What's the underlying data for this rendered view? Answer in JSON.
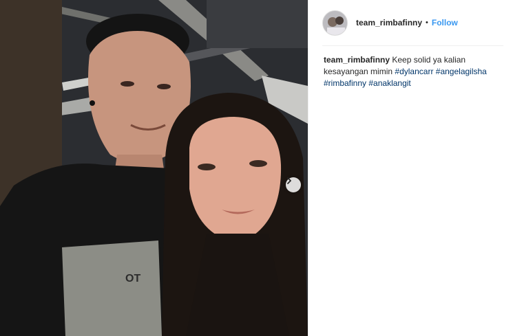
{
  "post": {
    "username": "team_rimbafinny",
    "separator": "•",
    "follow_label": "Follow"
  },
  "caption": {
    "username": "team_rimbafinny",
    "text": "Keep solid ya kalian kesayangan mimin",
    "hashtags": [
      "#dylancarr",
      "#angelagilsha",
      "#rimbafinny",
      "#anaklangit"
    ]
  },
  "photo": {
    "shirt_print": "OT"
  },
  "colors": {
    "link_blue": "#3897f0",
    "hashtag": "#003569",
    "text": "#262626"
  }
}
